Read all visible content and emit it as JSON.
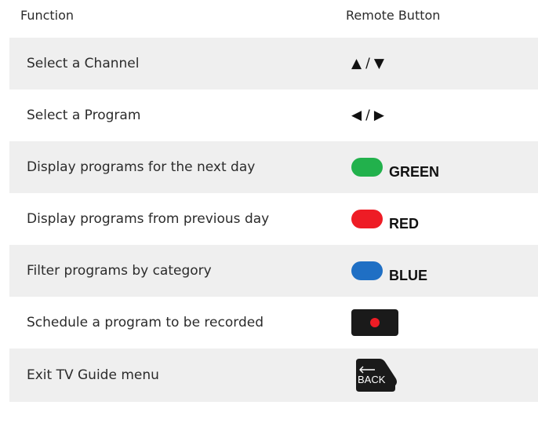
{
  "header": {
    "function": "Function",
    "remote_button": "Remote Button"
  },
  "rows": [
    {
      "function": "Select a Channel",
      "button": {
        "type": "arrows",
        "left": "▲",
        "sep": "/",
        "right": "▼"
      }
    },
    {
      "function": "Select a Program",
      "button": {
        "type": "arrows",
        "left": "◀",
        "sep": "/",
        "right": "▶"
      }
    },
    {
      "function": "Display programs for the next day",
      "button": {
        "type": "color",
        "label": "GREEN",
        "color": "#22b14c"
      }
    },
    {
      "function": "Display programs from previous day",
      "button": {
        "type": "color",
        "label": "RED",
        "color": "#ee1c25"
      }
    },
    {
      "function": "Filter programs by category",
      "button": {
        "type": "color",
        "label": "BLUE",
        "color": "#1f6fc4"
      }
    },
    {
      "function": "Schedule a program to be recorded",
      "button": {
        "type": "record",
        "icon": "record-icon"
      }
    },
    {
      "function": "Exit TV Guide menu",
      "button": {
        "type": "back",
        "label": "BACK",
        "icon": "back-arrow-icon"
      }
    }
  ],
  "colors": {
    "row_shade": "#efefef",
    "button_dark": "#1a1a1a"
  }
}
